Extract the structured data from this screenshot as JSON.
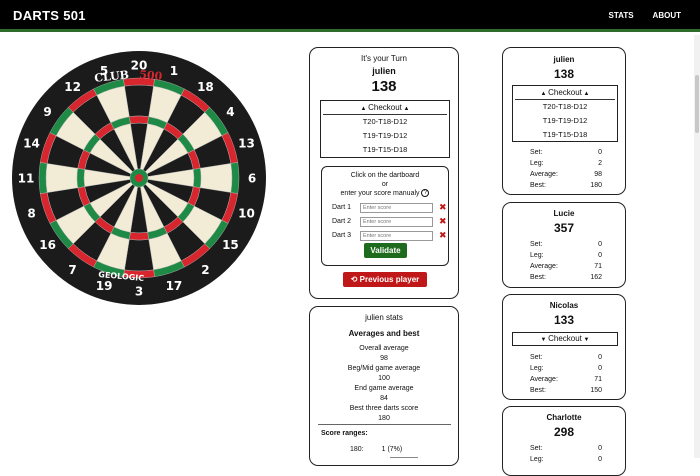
{
  "nav": {
    "brand": "DARTS 501",
    "links": [
      "STATS",
      "ABOUT"
    ]
  },
  "board": {
    "numbers": [
      "20",
      "1",
      "18",
      "4",
      "13",
      "6",
      "10",
      "15",
      "2",
      "17",
      "3",
      "19",
      "7",
      "16",
      "8",
      "11",
      "14",
      "9",
      "12",
      "5"
    ],
    "logo_top_left": "CLUB",
    "logo_top_right": "500",
    "logo_bottom": "GEOLOGIC",
    "colors": {
      "black": "#1b1b1b",
      "cream": "#f2ecd6",
      "red": "#d8262f",
      "green": "#1f8a45"
    }
  },
  "turn": {
    "title": "It's your Turn",
    "player": "julien",
    "score": "138",
    "checkout_label": "Checkout",
    "checkouts": [
      "T20-T18-D12",
      "T19-T19-D12",
      "T19-T15-D18"
    ],
    "hint_line1": "Click on the dartboard",
    "hint_line2": "or",
    "hint_line3": "enter your score manualy",
    "help_icon": "?",
    "darts": [
      {
        "label": "Dart 1",
        "placeholder": "Enter score"
      },
      {
        "label": "Dart 2",
        "placeholder": "Enter score"
      },
      {
        "label": "Dart 3",
        "placeholder": "Enter score"
      }
    ],
    "validate_label": "Validate",
    "previous_label": "Previous player",
    "previous_icon": "undo-icon"
  },
  "stats": {
    "title": "julien stats",
    "subtitle": "Averages and best",
    "lines": [
      "Overall average",
      "98",
      "Beg/Mid game average",
      "100",
      "End game average",
      "84",
      "Best three darts score",
      "180"
    ],
    "ranges_title": "Score ranges:",
    "range_label": "180:",
    "range_value": "1 (7%)"
  },
  "players": [
    {
      "name": "julien",
      "score": "138",
      "checkout_label": "Checkout",
      "checkouts": [
        "T20-T18-D12",
        "T19-T19-D12",
        "T19-T15-D18"
      ],
      "set": "0",
      "leg": "2",
      "average": "98",
      "best": "180"
    },
    {
      "name": "Lucie",
      "score": "357",
      "set": "0",
      "leg": "0",
      "average": "71",
      "best": "162"
    },
    {
      "name": "Nicolas",
      "score": "133",
      "checkout_label": "Checkout",
      "set": "0",
      "leg": "0",
      "average": "71",
      "best": "150"
    },
    {
      "name": "Charlotte",
      "score": "298",
      "set": "0",
      "leg": "0"
    }
  ],
  "stat_labels": {
    "set": "Set:",
    "leg": "Leg:",
    "average": "Average:",
    "best": "Best:"
  }
}
